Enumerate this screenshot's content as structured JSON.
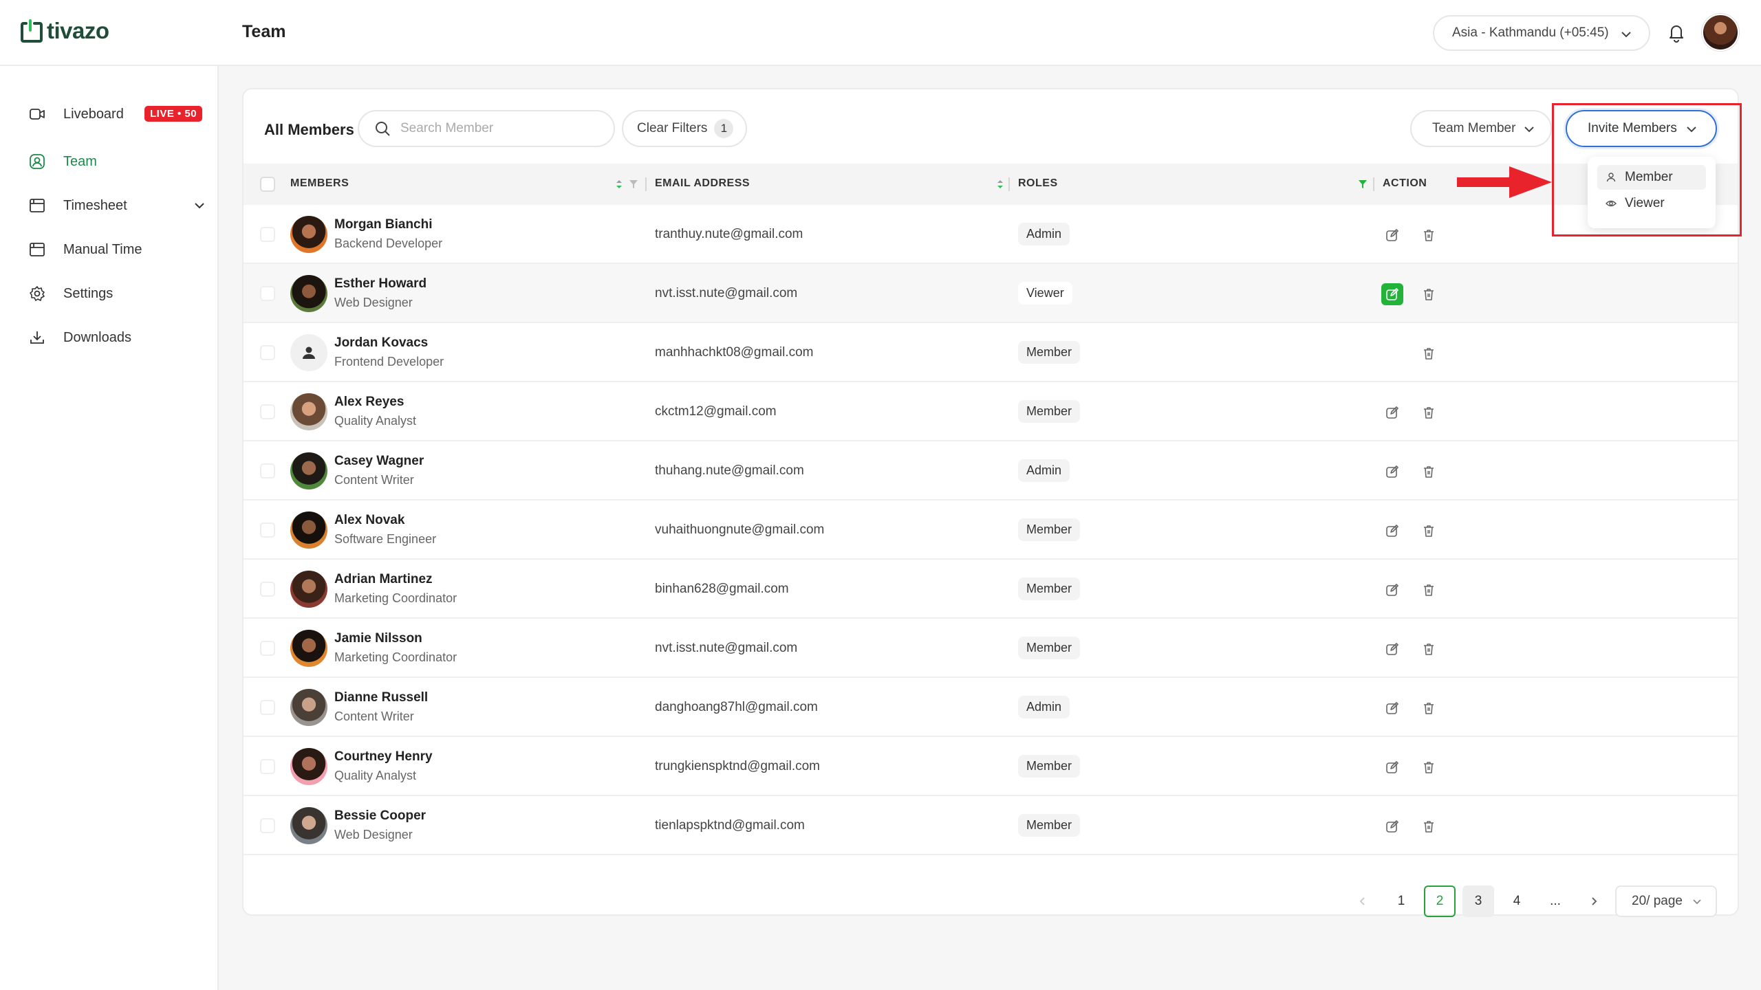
{
  "app": {
    "brand": "tivazo"
  },
  "header": {
    "page_title": "Team",
    "timezone": "Asia - Kathmandu (+05:45)"
  },
  "sidebar": {
    "items": [
      {
        "label": "Liveboard",
        "icon": "liveboard-icon",
        "badge": "LIVE • 50"
      },
      {
        "label": "Team",
        "icon": "team-icon",
        "active": true
      },
      {
        "label": "Timesheet",
        "icon": "timesheet-icon",
        "expandable": true
      },
      {
        "label": "Manual Time",
        "icon": "manual-time-icon"
      },
      {
        "label": "Settings",
        "icon": "gear-icon"
      },
      {
        "label": "Downloads",
        "icon": "download-icon"
      }
    ]
  },
  "toolbar": {
    "title": "All Members",
    "search_placeholder": "Search Member",
    "clear_filters_label": "Clear Filters",
    "clear_filters_count": "1",
    "role_filter": "Team Member",
    "invite_label": "Invite Members"
  },
  "invite_menu": {
    "items": [
      {
        "label": "Member",
        "icon": "user-icon"
      },
      {
        "label": "Viewer",
        "icon": "eye-icon"
      }
    ]
  },
  "table": {
    "columns": [
      "MEMBERS",
      "EMAIL ADDRESS",
      "ROLES",
      "ACTION"
    ],
    "rows": [
      {
        "name": "Morgan Bianchi",
        "title": "Backend Developer",
        "email": "tranthuy.nute@gmail.com",
        "role": "Admin"
      },
      {
        "name": "Esther Howard",
        "title": "Web Designer",
        "email": "nvt.isst.nute@gmail.com",
        "role": "Viewer"
      },
      {
        "name": "Jordan Kovacs",
        "title": "Frontend Developer",
        "email": "manhhachkt08@gmail.com",
        "role": "Member"
      },
      {
        "name": "Alex Reyes",
        "title": "Quality Analyst",
        "email": "ckctm12@gmail.com",
        "role": "Member"
      },
      {
        "name": "Casey Wagner",
        "title": "Content Writer",
        "email": "thuhang.nute@gmail.com",
        "role": "Admin"
      },
      {
        "name": "Alex Novak",
        "title": "Software Engineer",
        "email": "vuhaithuongnute@gmail.com",
        "role": "Member"
      },
      {
        "name": "Adrian Martinez",
        "title": "Marketing Coordinator",
        "email": "binhan628@gmail.com",
        "role": "Member"
      },
      {
        "name": "Jamie Nilsson",
        "title": "Marketing Coordinator",
        "email": "nvt.isst.nute@gmail.com",
        "role": "Member"
      },
      {
        "name": "Dianne Russell",
        "title": "Content Writer",
        "email": "danghoang87hl@gmail.com",
        "role": "Admin"
      },
      {
        "name": "Courtney Henry",
        "title": "Quality Analyst",
        "email": "trungkienspktnd@gmail.com",
        "role": "Member"
      },
      {
        "name": "Bessie Cooper",
        "title": "Web Designer",
        "email": "tienlapspktnd@gmail.com",
        "role": "Member"
      }
    ]
  },
  "pagination": {
    "pages": [
      "1",
      "2",
      "3",
      "4",
      "..."
    ],
    "current": "2",
    "page_size": "20/ page"
  },
  "colors": {
    "accent": "#1a8a4a",
    "live": "#e8232c",
    "focus": "#2f6fd6",
    "edit_active": "#23b33a",
    "annotation": "#e8232c"
  }
}
